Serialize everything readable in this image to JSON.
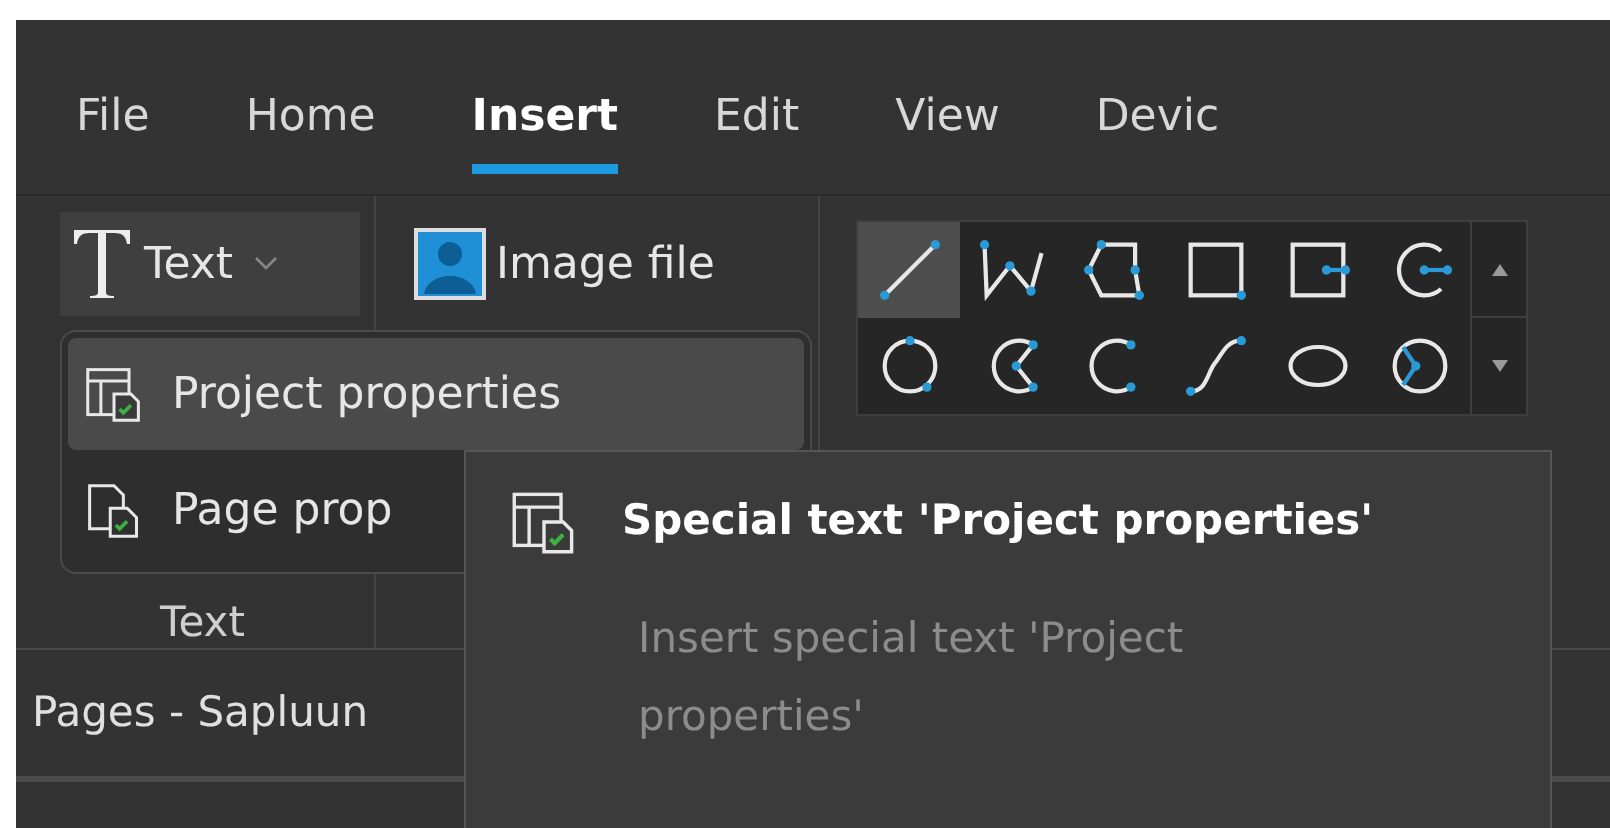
{
  "menu_tabs": [
    {
      "label": "File",
      "selected": false
    },
    {
      "label": "Home",
      "selected": false
    },
    {
      "label": "Insert",
      "selected": true
    },
    {
      "label": "Edit",
      "selected": false
    },
    {
      "label": "View",
      "selected": false
    },
    {
      "label": "Devic",
      "selected": false
    }
  ],
  "ribbon": {
    "text_button": "Text",
    "image_button": "Image file",
    "group_label": "Text",
    "shapes": [
      {
        "selected": true
      },
      {
        "selected": false
      },
      {
        "selected": false
      },
      {
        "selected": false
      },
      {
        "selected": false
      },
      {
        "selected": false
      },
      {
        "selected": false
      },
      {
        "selected": false
      },
      {
        "selected": false
      },
      {
        "selected": false
      },
      {
        "selected": false
      },
      {
        "selected": false
      }
    ]
  },
  "dropdown": {
    "items": [
      {
        "label": "Project properties",
        "kind": "project",
        "selected": true
      },
      {
        "label": "Page prop",
        "kind": "page",
        "selected": false
      }
    ]
  },
  "tooltip": {
    "title": "Special text 'Project properties'",
    "description": "Insert special text 'Project properties'"
  },
  "pages_panel": {
    "title": "Pages - Sapluun"
  }
}
